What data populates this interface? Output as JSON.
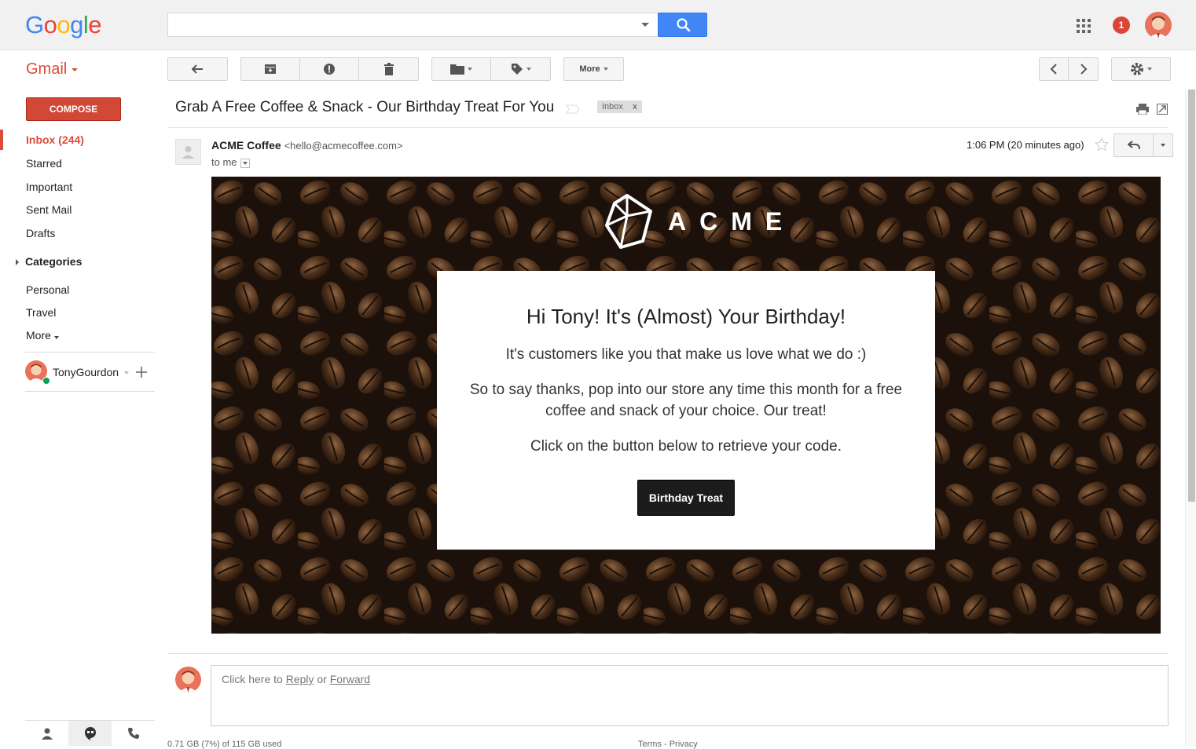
{
  "header": {
    "logo_letters": [
      "G",
      "o",
      "o",
      "g",
      "l",
      "e"
    ],
    "logo_colors": [
      "#4285f4",
      "#ea4335",
      "#fbbc05",
      "#4285f4",
      "#34a853",
      "#ea4335"
    ],
    "search_placeholder": "",
    "notifications_count": "1"
  },
  "app": {
    "name": "Gmail"
  },
  "toolbar": {
    "more_label": "More"
  },
  "sidebar": {
    "compose_label": "COMPOSE",
    "items": [
      {
        "label": "Inbox (244)",
        "active": true
      },
      {
        "label": "Starred"
      },
      {
        "label": "Important"
      },
      {
        "label": "Sent Mail"
      },
      {
        "label": "Drafts"
      }
    ],
    "categories_label": "Categories",
    "sub_items": [
      {
        "label": "Personal"
      },
      {
        "label": "Travel"
      },
      {
        "label": "More"
      }
    ],
    "user_name": "TonyGourdon"
  },
  "message": {
    "subject": "Grab A Free Coffee & Snack - Our Birthday Treat For You",
    "label": "Inbox",
    "label_remove": "x",
    "sender_name": "ACME Coffee",
    "sender_email": "<hello@acmecoffee.com>",
    "recipient": "to me",
    "timestamp": "1:06 PM (20 minutes ago)"
  },
  "email": {
    "brand": "ACME",
    "heading": "Hi Tony! It's (Almost) Your Birthday!",
    "p1": "It's customers like you that make us love what we do :)",
    "p2": "So to say thanks, pop into our store any time this month for a free coffee and snack of your choice. Our treat!",
    "p3": "Click on the button below to retrieve your code.",
    "cta": "Birthday Treat"
  },
  "reply": {
    "prefix": "Click here to ",
    "reply_link": "Reply",
    "or": " or ",
    "forward_link": "Forward"
  },
  "footer": {
    "storage": "0.71 GB (7%) of 115 GB used",
    "terms": "Terms - Privacy"
  }
}
